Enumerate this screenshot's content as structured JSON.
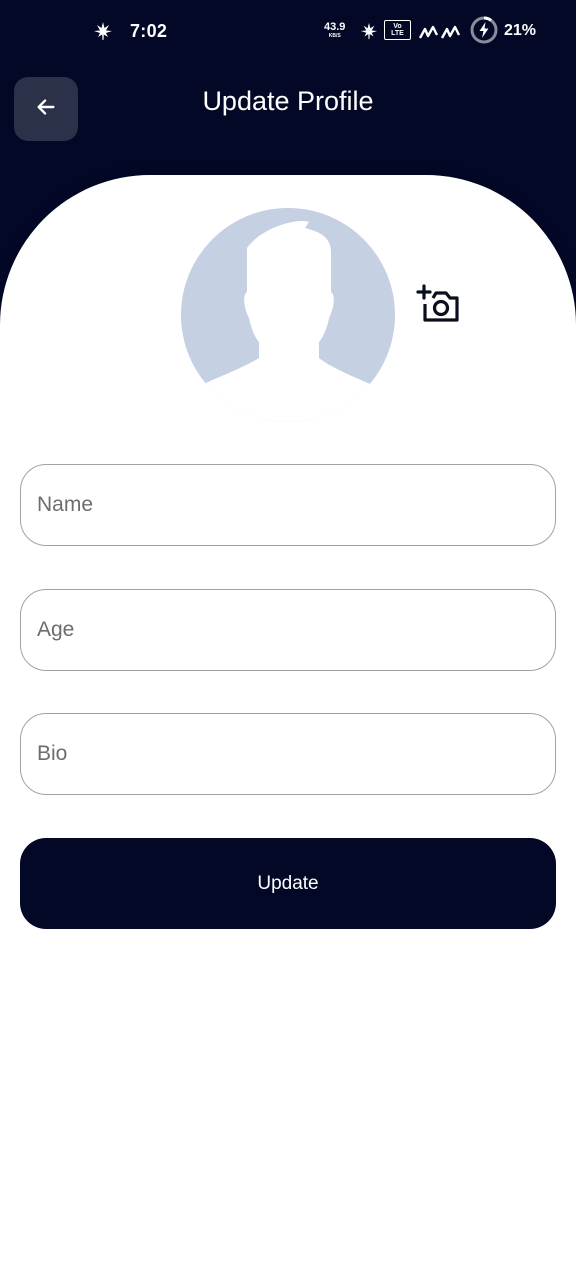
{
  "status_bar": {
    "time": "7:02",
    "net_speed_value": "43.9",
    "net_speed_unit": "KB/S",
    "volte_top": "Vo",
    "volte_bottom": "LTE",
    "battery_percent": "21%",
    "icons": [
      "cannabis-leaf-icon",
      "cannabis-leaf-icon",
      "volte-icon",
      "signal-icon",
      "signal-icon",
      "battery-charging-icon"
    ]
  },
  "app_bar": {
    "title": "Update Profile",
    "back_icon": "arrow-left-icon"
  },
  "profile": {
    "avatar_icon": "default-avatar-silhouette",
    "camera_icon": "add-a-photo-icon"
  },
  "form": {
    "name_placeholder": "Name",
    "name_value": "",
    "age_placeholder": "Age",
    "age_value": "",
    "bio_placeholder": "Bio",
    "bio_value": "",
    "submit_label": "Update"
  },
  "colors": {
    "primary_dark": "#020826",
    "back_button_bg": "#2b3148",
    "avatar_bg": "#c5d0e3",
    "input_border": "#a3a3a3"
  }
}
